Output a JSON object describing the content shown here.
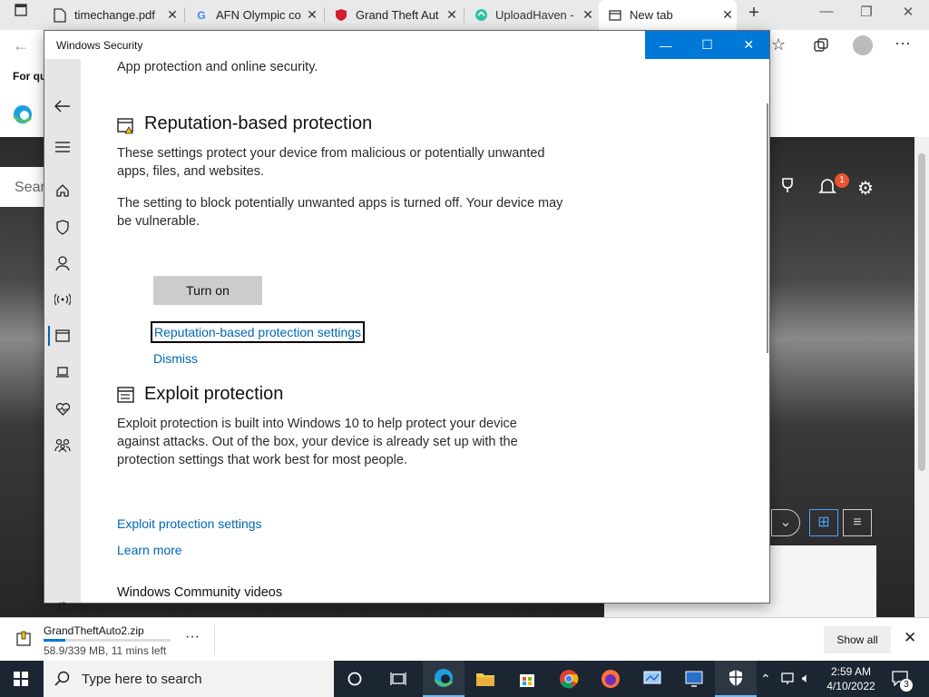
{
  "browser": {
    "tabs": [
      {
        "title": "timechange.pdf",
        "icon": "pdf-icon"
      },
      {
        "title": "AFN Olympic co",
        "icon": "google-icon"
      },
      {
        "title": "Grand Theft Aut",
        "icon": "shield-red-icon"
      },
      {
        "title": "UploadHaven - ",
        "icon": "uploadhaven-icon"
      },
      {
        "title": "New tab",
        "icon": "newtab-icon"
      }
    ],
    "favorites_label": "For qu",
    "search_partial": "Sear",
    "notification_count": "1"
  },
  "window": {
    "title": "Windows Security",
    "intro_text": "App protection and online security.",
    "reputation": {
      "heading": "Reputation-based protection",
      "desc": "These settings protect your device from malicious or potentially unwanted apps, files, and websites.",
      "warning": "The setting to block potentially unwanted apps is turned off. Your device may be vulnerable.",
      "turn_on_label": "Turn on",
      "settings_link": "Reputation-based protection settings",
      "dismiss_link": "Dismiss"
    },
    "exploit": {
      "heading": "Exploit protection",
      "desc": "Exploit protection is built into Windows 10 to help protect your device against attacks.  Out of the box, your device is already set up with the protection settings that work best for most people.",
      "settings_link": "Exploit protection settings",
      "learn_more_link": "Learn more"
    },
    "community_heading": "Windows Community videos",
    "nav_items": [
      "back",
      "menu",
      "home",
      "virus-protection",
      "account",
      "firewall",
      "app-browser-control",
      "device-security",
      "device-health",
      "family",
      "settings"
    ],
    "accent": "#0078d7"
  },
  "download": {
    "filename": "GrandTheftAuto2.zip",
    "status": "58.9/339 MB, 11 mins left",
    "progress_fraction": 0.174,
    "show_all_label": "Show all"
  },
  "taskbar": {
    "search_placeholder": "Type here to search",
    "time": "2:59 AM",
    "date": "4/10/2022",
    "notification_count": "3"
  }
}
